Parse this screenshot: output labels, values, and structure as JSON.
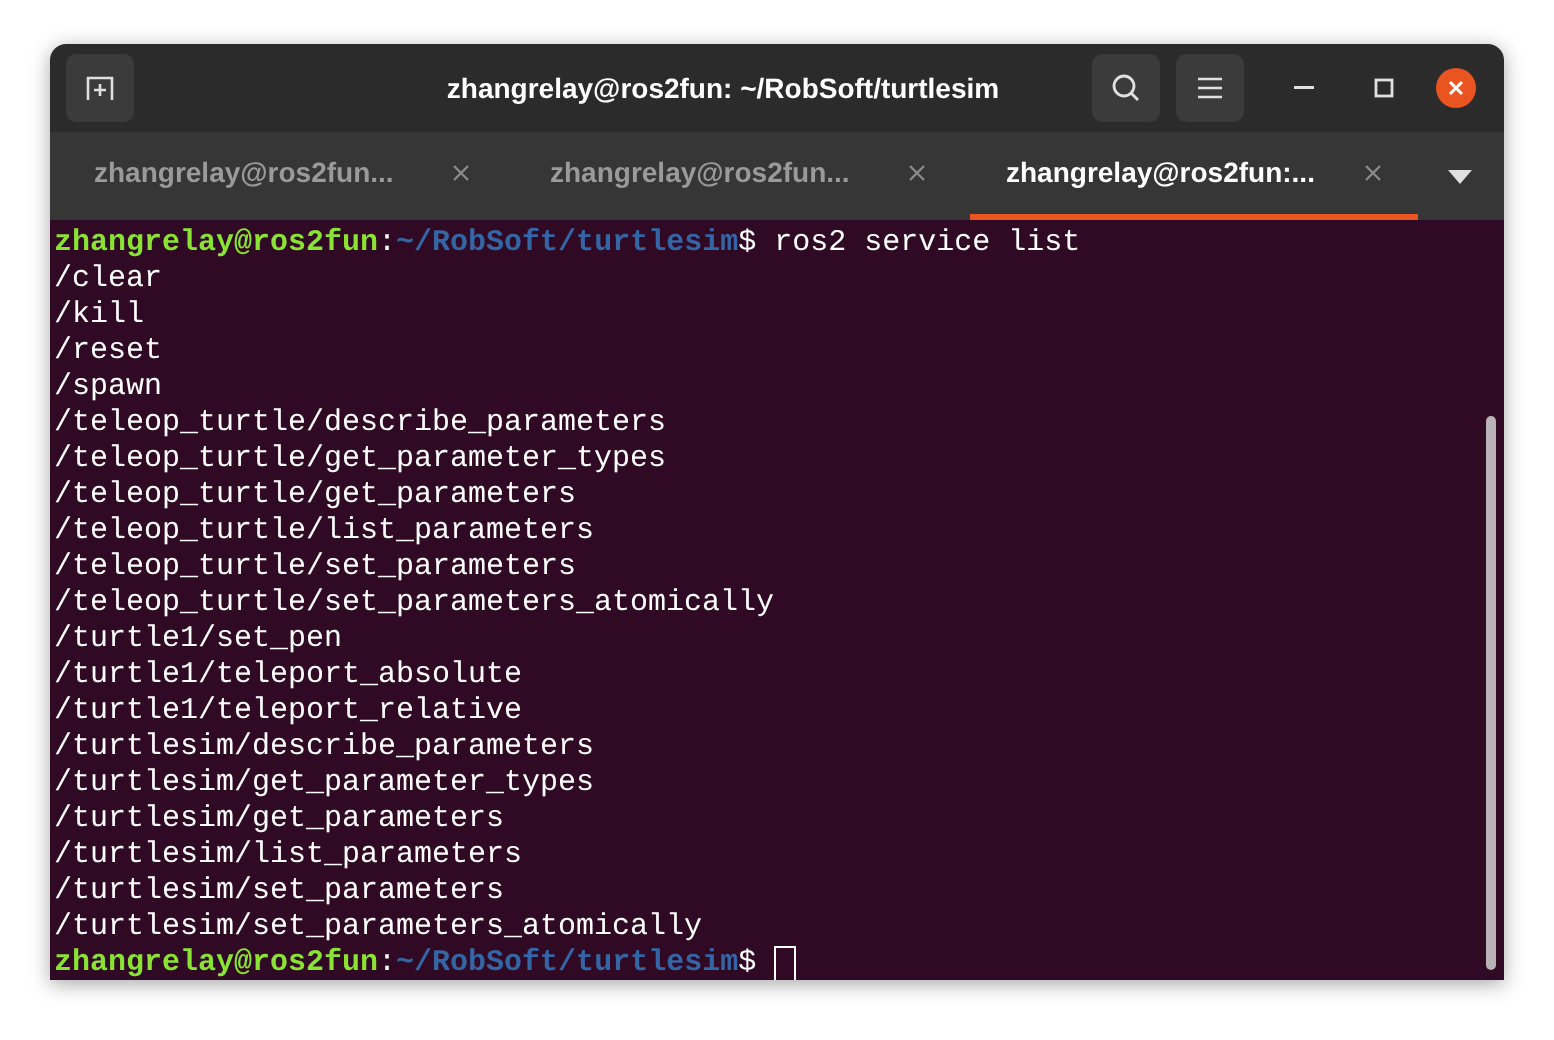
{
  "window": {
    "title": "zhangrelay@ros2fun: ~/RobSoft/turtlesim"
  },
  "tabs": [
    {
      "label": "zhangrelay@ros2fun...",
      "selected": false
    },
    {
      "label": "zhangrelay@ros2fun...",
      "selected": false
    },
    {
      "label": "zhangrelay@ros2fun:...",
      "selected": true
    }
  ],
  "terminal": {
    "lines": [
      {
        "kind": "prompt",
        "user": "zhangrelay@ros2fun",
        "sep": ":",
        "path": "~/RobSoft/turtlesim",
        "symbol": "$",
        "command": "ros2 service list",
        "cursor": false
      },
      {
        "kind": "output",
        "text": "/clear"
      },
      {
        "kind": "output",
        "text": "/kill"
      },
      {
        "kind": "output",
        "text": "/reset"
      },
      {
        "kind": "output",
        "text": "/spawn"
      },
      {
        "kind": "output",
        "text": "/teleop_turtle/describe_parameters"
      },
      {
        "kind": "output",
        "text": "/teleop_turtle/get_parameter_types"
      },
      {
        "kind": "output",
        "text": "/teleop_turtle/get_parameters"
      },
      {
        "kind": "output",
        "text": "/teleop_turtle/list_parameters"
      },
      {
        "kind": "output",
        "text": "/teleop_turtle/set_parameters"
      },
      {
        "kind": "output",
        "text": "/teleop_turtle/set_parameters_atomically"
      },
      {
        "kind": "output",
        "text": "/turtle1/set_pen"
      },
      {
        "kind": "output",
        "text": "/turtle1/teleport_absolute"
      },
      {
        "kind": "output",
        "text": "/turtle1/teleport_relative"
      },
      {
        "kind": "output",
        "text": "/turtlesim/describe_parameters"
      },
      {
        "kind": "output",
        "text": "/turtlesim/get_parameter_types"
      },
      {
        "kind": "output",
        "text": "/turtlesim/get_parameters"
      },
      {
        "kind": "output",
        "text": "/turtlesim/list_parameters"
      },
      {
        "kind": "output",
        "text": "/turtlesim/set_parameters"
      },
      {
        "kind": "output",
        "text": "/turtlesim/set_parameters_atomically"
      },
      {
        "kind": "prompt",
        "user": "zhangrelay@ros2fun",
        "sep": ":",
        "path": "~/RobSoft/turtlesim",
        "symbol": "$",
        "cursor": true
      }
    ]
  }
}
